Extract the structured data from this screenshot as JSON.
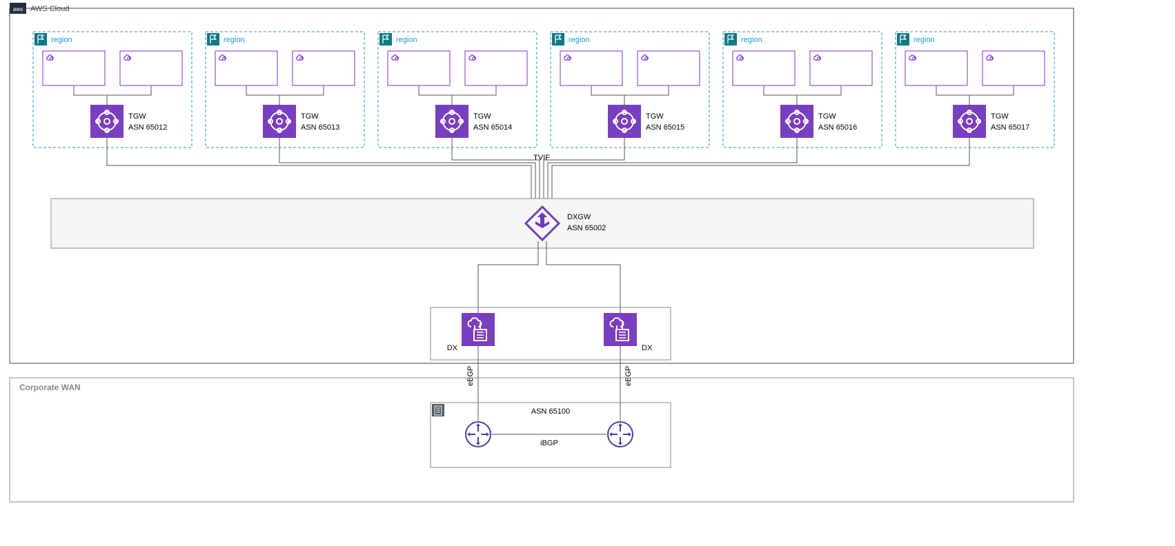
{
  "cloud_label": "AWS Cloud",
  "regions": [
    {
      "label": "region",
      "tgw_label": "TGW",
      "tgw_asn": "ASN 65012"
    },
    {
      "label": "region",
      "tgw_label": "TGW",
      "tgw_asn": "ASN 65013"
    },
    {
      "label": "region",
      "tgw_label": "TGW",
      "tgw_asn": "ASN 65014"
    },
    {
      "label": "region",
      "tgw_label": "TGW",
      "tgw_asn": "ASN 65015"
    },
    {
      "label": "region",
      "tgw_label": "TGW",
      "tgw_asn": "ASN 65016"
    },
    {
      "label": "region",
      "tgw_label": "TGW",
      "tgw_asn": "ASN 65017"
    }
  ],
  "tvif_label": "TVIF",
  "dxgw": {
    "label": "DXGW",
    "asn": "ASN 65002"
  },
  "dx_left": "DX",
  "dx_right": "DX",
  "ebgp_left": "eBGP",
  "ebgp_right": "eBGP",
  "corp_wan": "Corporate WAN",
  "router_asn": "ASN 65100",
  "ibgp": "iBGP"
}
